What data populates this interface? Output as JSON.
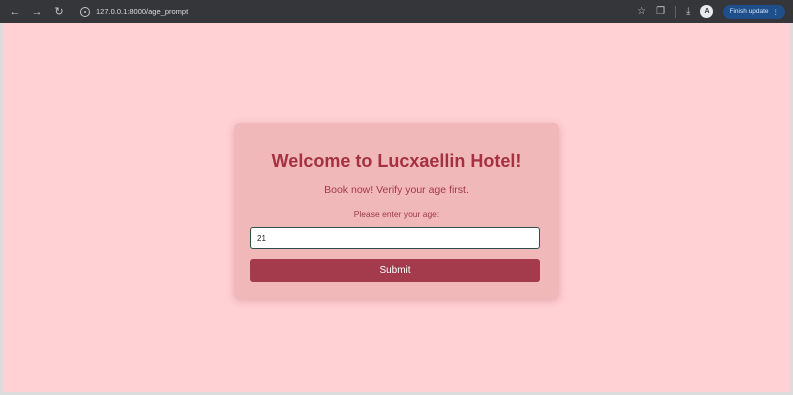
{
  "browser": {
    "url": "127.0.0.1:8000/age_prompt",
    "back_icon": "back-arrow-icon",
    "forward_icon": "forward-arrow-icon",
    "reload_icon": "reload-icon",
    "update_label": "Finish update",
    "avatar_letter": "A"
  },
  "card": {
    "title": "Welcome to Lucxaellin Hotel!",
    "subtitle": "Book now! Verify your age first.",
    "prompt_label": "Please enter your age:",
    "age_value": "21",
    "submit_label": "Submit"
  },
  "colors": {
    "page_background": "#ffd0d4",
    "card_background": "#f1b8ba",
    "title_color": "#a43140",
    "button_color": "#a33b4d"
  }
}
